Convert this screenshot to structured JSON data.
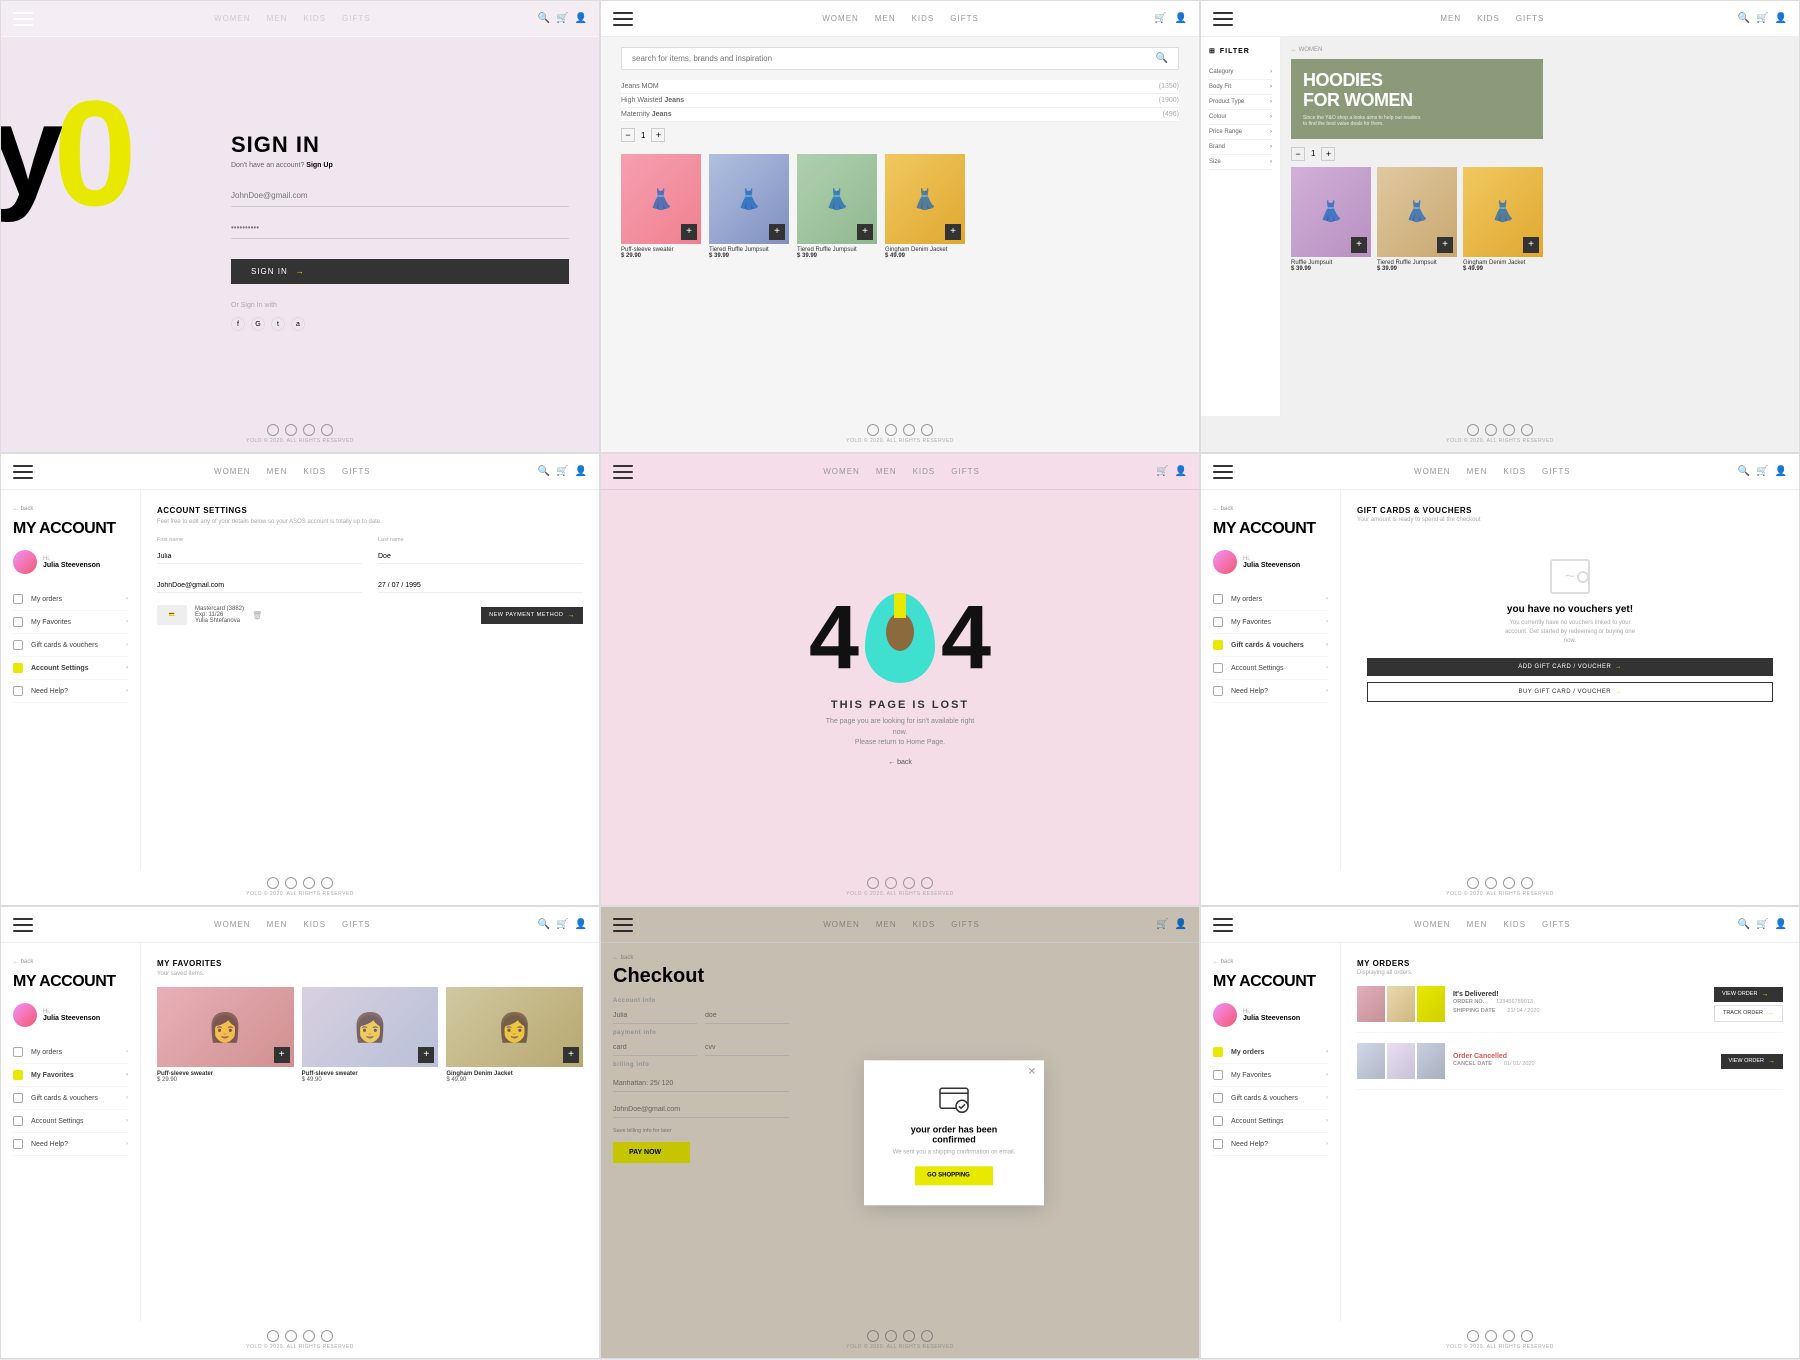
{
  "brand": "YOLO",
  "copyright": "YOLO © 2020. ALL RIGHTS RESERVED",
  "nav": {
    "items": [
      "WOMEN",
      "MEN",
      "KIDS",
      "GIFTS"
    ],
    "hamburger_label": "menu"
  },
  "cell1": {
    "title": "SIGN IN",
    "subtitle": "Don't have an account?",
    "signup_link": "Sign Up",
    "email_placeholder": "JohnDoe@gmail.com",
    "password_placeholder": "••••••••••",
    "button_label": "SIGN IN",
    "or_label": "Or Sign In with",
    "yo_y": "y",
    "yo_o": "0"
  },
  "cell2": {
    "search_placeholder": "search for items, brands and inspiration",
    "suggestions": [
      {
        "label": "Jeans MOM",
        "count": "(1350)"
      },
      {
        "label": "High Waisted Jeans",
        "count": "(1900)"
      },
      {
        "label": "Maternity Jeans",
        "count": "(496)"
      }
    ],
    "products": [
      {
        "name": "Puff-sleeve sweater",
        "price": "$ 29.90"
      },
      {
        "name": "Tiered Ruffle Jumpsuit",
        "price": "$ 39.99"
      },
      {
        "name": "Tiered Ruffle Jumpsuit",
        "price": "$ 39.99"
      },
      {
        "name": "Gingham Denim Jacket",
        "price": "$ 49.99"
      }
    ]
  },
  "cell3": {
    "breadcrumb": "← WOMEN",
    "title": "HOODIES",
    "title2": "FOR WOMEN",
    "filter_title": "FILTER",
    "filters": [
      "Category",
      "Body Fit",
      "Product Type",
      "Colour",
      "Price Range",
      "Brand",
      "Size"
    ]
  },
  "cell4": {
    "back": "← back",
    "title": "MY ACCOUNT",
    "user_hi": "Hi,",
    "user_name": "Julia Steevenson",
    "settings_title": "ACCOUNT SETTINGS",
    "settings_desc": "Feel free to edit any of your details below so your ASOS account is totally up to date.",
    "fields": {
      "first_name_label": "First name",
      "first_name_value": "Julia",
      "last_name_label": "Last name",
      "last_name_value": "Doe",
      "email_label": "",
      "email_value": "JohnDoe@gmail.com",
      "dob_label": "",
      "dob_value": "27 / 07 / 1995"
    },
    "payment_label": "Mastercard (3882)",
    "payment_exp": "Exp: 11/26",
    "payment_name": "Yulia Shtefanova",
    "new_payment_btn": "NEW PAYMENT METHOD",
    "nav_items": [
      "My orders",
      "My Favorites",
      "Gift cards & vouchers",
      "Account Settings",
      "Need Help?"
    ]
  },
  "cell5": {
    "four": "4",
    "o": "0",
    "four2": "4",
    "headline": "THIS PAGE IS LOST",
    "description1": "The page you are looking for isn't available right now.",
    "description2": "Please return to Home Page.",
    "back_btn": "← back"
  },
  "cell6": {
    "back": "← back",
    "title": "MY ACCOUNT",
    "user_hi": "Hi,",
    "user_name": "Julia Steevenson",
    "gift_title": "GIFT CARDS & VOUCHERS",
    "gift_sub": "Your amount is ready to spend at the checkout",
    "voucher_title": "you have no vouchers yet!",
    "voucher_desc": "You currently have no vouchers linked to your account. Get started by redeeming or buying one now.",
    "add_btn": "ADD GIFT CARD / VOUCHER",
    "buy_btn": "BUY GIFT CARD / VOUCHER",
    "nav_items": [
      "My orders",
      "My Favorites",
      "Gift cards & vouchers",
      "Account Settings",
      "Need Help?"
    ]
  },
  "cell7": {
    "back": "← back",
    "title": "MY ACCOUNT",
    "user_hi": "Hi,",
    "user_name": "Julia Steevenson",
    "favorites_title": "MY FAVORITES",
    "favorites_sub": "Your saved items.",
    "items": [
      {
        "name": "Puff-sleeve sweater",
        "price": "$ 29.90"
      },
      {
        "name": "Puff-sleeve sweater",
        "price": "$ 49.90"
      },
      {
        "name": "Gingham Denim Jacket",
        "price": "$ 49.90"
      }
    ],
    "nav_items": [
      "My orders",
      "My Favorites",
      "Gift cards & vouchers",
      "Account Settings",
      "Need Help?"
    ]
  },
  "cell8": {
    "back": "← back",
    "checkout_title": "Checkout",
    "account_section": "Account Info",
    "account_name_placeholder": "Julia",
    "account_email_placeholder": "doe",
    "payment_section": "payment info",
    "card_placeholder": "card",
    "cvv_placeholder": "cvv",
    "billing_section": "billing info",
    "address_placeholder": "Manhattan: 25/ 120",
    "email_placeholder": "JohnDoe@gmail.com",
    "pay_btn": "PAY NOW",
    "save_billing": "Save billing info for later",
    "modal_title": "your order has been confirmed",
    "modal_desc": "We sent you a shipping confirmation on email.",
    "modal_btn": "GO SHOPPING"
  },
  "cell9": {
    "back": "← back",
    "title": "MY ACCOUNT",
    "user_hi": "Hi,",
    "user_name": "Julia Steevenson",
    "orders_title": "MY ORDERS",
    "orders_sub": "Displaying all orders.",
    "orders": [
      {
        "status": "It's Delivered!",
        "order_no_label": "ORDER NO.",
        "order_no": "123456789013",
        "shipping_label": "SHIPPING DATE",
        "shipping_date": "21/ 04 / 2020",
        "view_btn": "VIEW ORDER",
        "track_btn": "TRACK ORDER"
      },
      {
        "status": "Order Cancelled",
        "order_no_label": "ORDER NO.",
        "order_no": "",
        "shipping_label": "CANCEL DATE",
        "shipping_date": "01/ 01/ 2020",
        "view_btn": "VIEW ORDER",
        "track_btn": ""
      }
    ],
    "nav_items": [
      "My orders",
      "My Favorites",
      "Gift cards & vouchers",
      "Account Settings",
      "Need Help?"
    ]
  }
}
